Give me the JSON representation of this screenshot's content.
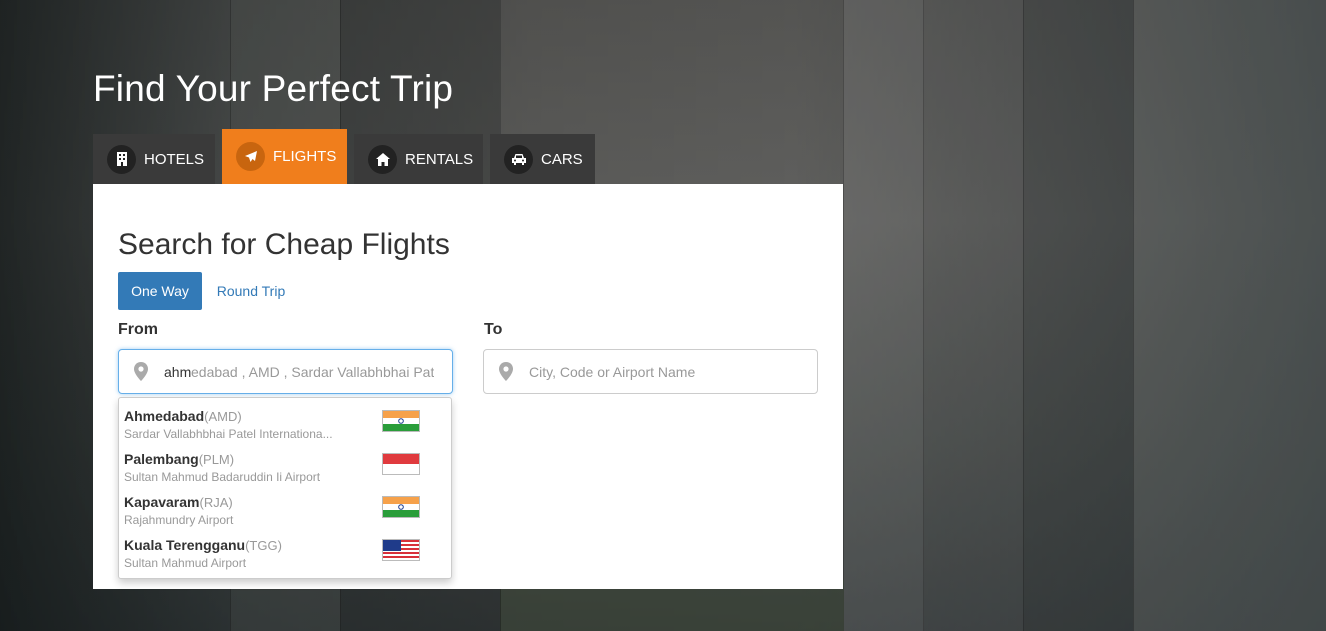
{
  "hero": {
    "title": "Find Your Perfect Trip"
  },
  "tabs": [
    {
      "label": "HOTELS",
      "icon": "hotel-icon",
      "active": false
    },
    {
      "label": "FLIGHTS",
      "icon": "plane-icon",
      "active": true
    },
    {
      "label": "RENTALS",
      "icon": "home-icon",
      "active": false
    },
    {
      "label": "CARS",
      "icon": "car-icon",
      "active": false
    }
  ],
  "search": {
    "title": "Search for Cheap Flights",
    "trip_types": {
      "one_way": "One Way",
      "round_trip": "Round Trip",
      "selected": "One Way"
    },
    "from": {
      "label": "From",
      "value": "ahm",
      "hint": "edabad , AMD , Sardar Vallabhbhai Patel I"
    },
    "to": {
      "label": "To",
      "placeholder": "City, Code or Airport Name"
    }
  },
  "suggestions": [
    {
      "city": "Ahmedabad",
      "code": "(AMD)",
      "airport": "Sardar Vallabhbhai Patel Internationa...",
      "flag": "india"
    },
    {
      "city": "Palembang",
      "code": "(PLM)",
      "airport": "Sultan Mahmud Badaruddin Ii Airport",
      "flag": "indonesia"
    },
    {
      "city": "Kapavaram",
      "code": "(RJA)",
      "airport": "Rajahmundry Airport",
      "flag": "india"
    },
    {
      "city": "Kuala Terengganu",
      "code": "(TGG)",
      "airport": "Sultan Mahmud Airport",
      "flag": "malaysia"
    }
  ],
  "colors": {
    "accent": "#f07e1c",
    "primary": "#337ab7",
    "tab_bg": "#3a3a3a"
  }
}
